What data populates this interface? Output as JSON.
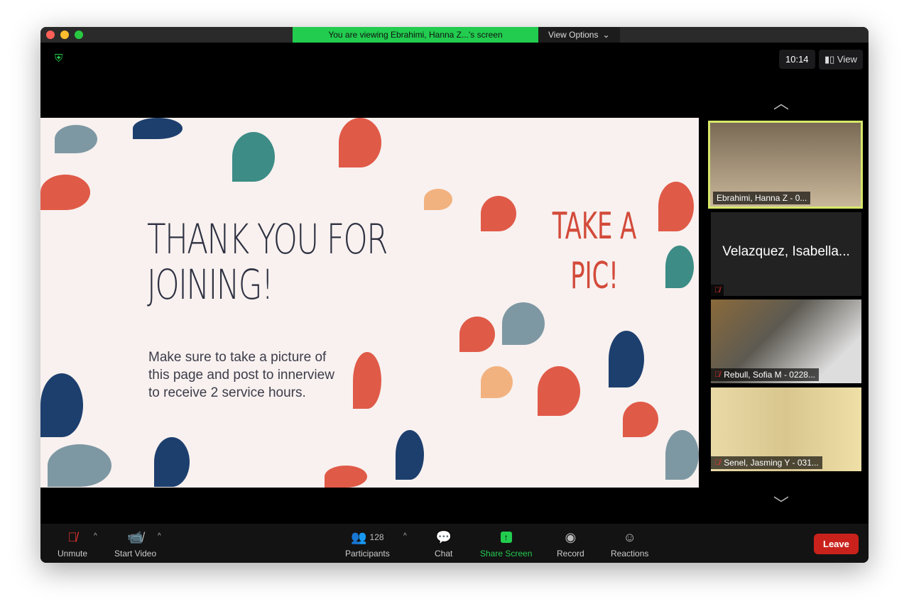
{
  "banner": {
    "text": "You are viewing Ebrahimi, Hanna Z...'s screen",
    "view_options": "View Options"
  },
  "clock": "10:14",
  "view_label": "View",
  "slide": {
    "title": "THANK YOU FOR JOINING!",
    "body": "Make sure to take a picture of this page and post to innerview to receive 2 service hours.",
    "side_text": "TAKE A PIC!"
  },
  "participants": [
    {
      "name": "Ebrahimi, Hanna Z - 0..."
    },
    {
      "name": "Velazquez, Isabella..."
    },
    {
      "name": "Rebull, Sofia M - 0228..."
    },
    {
      "name": "Senel, Jasming Y - 031..."
    }
  ],
  "toolbar": {
    "unmute": "Unmute",
    "start_video": "Start Video",
    "participants": "Participants",
    "participant_count": "128",
    "chat": "Chat",
    "share": "Share Screen",
    "record": "Record",
    "reactions": "Reactions",
    "leave": "Leave"
  },
  "colors": {
    "accent": "#22cc4f",
    "leave": "#c9221c",
    "active_speaker": "#d7e86a"
  }
}
